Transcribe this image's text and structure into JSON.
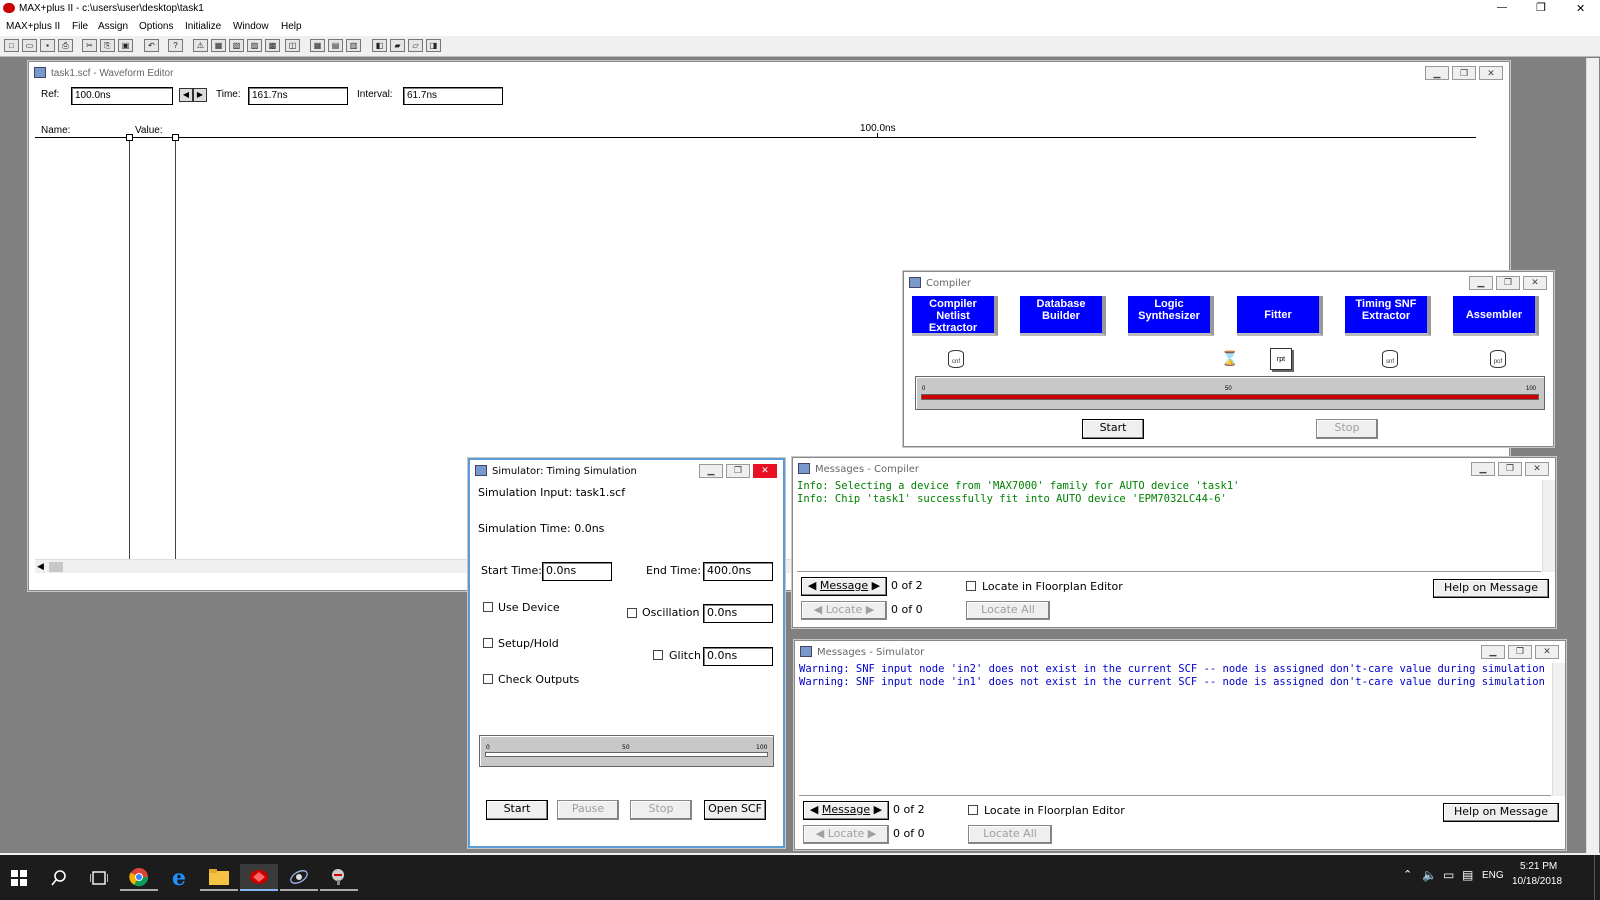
{
  "app": {
    "title": "MAX+plus II - c:\\users\\user\\desktop\\task1",
    "title_controls": [
      "—",
      "❐",
      "✕"
    ]
  },
  "menu": [
    "MAX+plus II",
    "File",
    "Assign",
    "Options",
    "Initialize",
    "Window",
    "Help"
  ],
  "toolbar_icons": [
    "new-icon",
    "open-icon",
    "save-icon",
    "print-icon",
    "cut-icon",
    "copy-icon",
    "paste-icon",
    "undo-icon",
    "help-cursor-icon",
    "hierarchy-icon",
    "floorplan-icon",
    "graphic-editor-icon",
    "symbol-editor-icon",
    "text-editor-icon",
    "waveform-editor-icon",
    "compiler-icon",
    "simulator-icon",
    "timing-analyzer-icon",
    "programmer-icon",
    "save-check-icon",
    "save-compile-icon",
    "save-simulate-icon"
  ],
  "waveform": {
    "title": "task1.scf - Waveform Editor",
    "ref_label": "Ref:",
    "ref_value": "100.0ns",
    "time_label": "Time:",
    "time_value": "161.7ns",
    "interval_label": "Interval:",
    "interval_value": "61.7ns",
    "name_header": "Name:",
    "value_header": "Value:",
    "ruler_mark": "100.0ns"
  },
  "compiler": {
    "title": "Compiler",
    "stages": [
      {
        "label": "Compiler Netlist Extractor",
        "file": "cnf"
      },
      {
        "label": "Database Builder",
        "file": ""
      },
      {
        "label": "Logic Synthesizer",
        "file": ""
      },
      {
        "label": "Fitter",
        "file": "rpt"
      },
      {
        "label": "Timing SNF Extractor",
        "file": "snf"
      },
      {
        "label": "Assembler",
        "file": "pof"
      }
    ],
    "progress": 1.0,
    "progress_ticks": [
      "0",
      "50",
      "100"
    ],
    "start_label": "Start",
    "stop_label": "Stop",
    "bar_color": "#cc0000"
  },
  "simulator": {
    "title": "Simulator: Timing Simulation",
    "input_text": "Simulation Input: task1.scf",
    "time_text": "Simulation Time: 0.0ns",
    "start_time_label": "Start Time:",
    "start_time_value": "0.0ns",
    "end_time_label": "End Time:",
    "end_time_value": "400.0ns",
    "use_device": "Use Device",
    "setup_hold": "Setup/Hold",
    "check_outputs": "Check Outputs",
    "oscillation_label": "Oscillation",
    "oscillation_value": "0.0ns",
    "glitch_label": "Glitch",
    "glitch_value": "0.0ns",
    "progress": 0,
    "progress_ticks": [
      "0",
      "50",
      "100"
    ],
    "start_label": "Start",
    "pause_label": "Pause",
    "stop_label": "Stop",
    "open_scf_label": "Open SCF"
  },
  "messages_compiler": {
    "title": "Messages - Compiler",
    "lines": [
      "Info: Selecting a device from 'MAX7000' family for AUTO device 'task1'",
      "Info: Chip 'task1' successfully fit into AUTO device 'EPM7032LC44-6'"
    ],
    "text_color": "#008000",
    "message_label": "Message",
    "message_count": "0 of 2",
    "locate_label": "Locate",
    "locate_count": "0 of 0",
    "floorplan_label": "Locate in Floorplan Editor",
    "locate_all_label": "Locate All",
    "help_label": "Help on Message"
  },
  "messages_simulator": {
    "title": "Messages - Simulator",
    "lines": [
      "Warning: SNF input node 'in2' does not exist in the current SCF -- node is assigned don't-care value during simulation",
      "Warning: SNF input node 'in1' does not exist in the current SCF -- node is assigned don't-care value during simulation"
    ],
    "text_color": "#0000cc",
    "message_label": "Message",
    "message_count": "0 of 2",
    "locate_label": "Locate",
    "locate_count": "0 of 0",
    "floorplan_label": "Locate in Floorplan Editor",
    "locate_all_label": "Locate All",
    "help_label": "Help on Message"
  },
  "taskbar": {
    "icons": [
      "windows-start-icon",
      "search-icon",
      "task-view-icon",
      "chrome-icon",
      "edge-icon",
      "file-explorer-icon",
      "maxplus-icon",
      "app-icon",
      "app2-icon"
    ],
    "tray": {
      "lang": "ENG",
      "time": "5:21 PM",
      "date": "10/18/2018"
    }
  }
}
